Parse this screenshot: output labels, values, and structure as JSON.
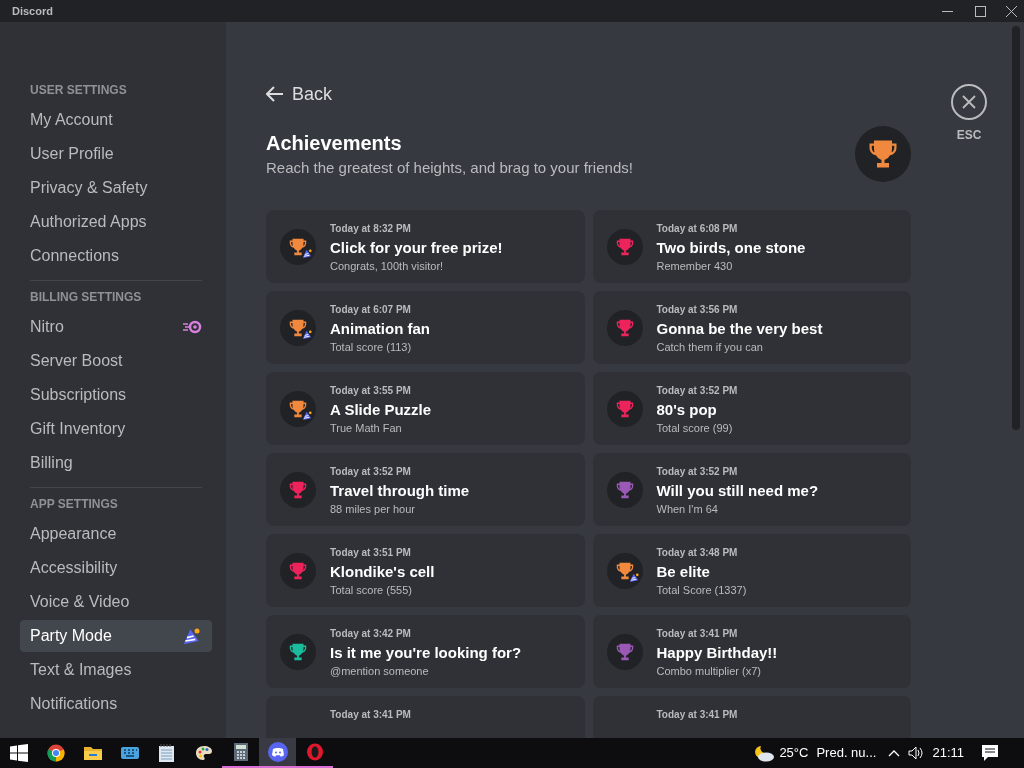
{
  "window": {
    "title": "Discord"
  },
  "sidebar": {
    "sections": [
      {
        "header": "USER SETTINGS",
        "items": [
          {
            "label": "My Account",
            "selected": false,
            "kind": "plain"
          },
          {
            "label": "User Profile",
            "selected": false,
            "kind": "plain"
          },
          {
            "label": "Privacy & Safety",
            "selected": false,
            "kind": "plain"
          },
          {
            "label": "Authorized Apps",
            "selected": false,
            "kind": "plain"
          },
          {
            "label": "Connections",
            "selected": false,
            "kind": "plain"
          }
        ]
      },
      {
        "header": "BILLING SETTINGS",
        "items": [
          {
            "label": "Nitro",
            "selected": false,
            "kind": "nitro"
          },
          {
            "label": "Server Boost",
            "selected": false,
            "kind": "plain"
          },
          {
            "label": "Subscriptions",
            "selected": false,
            "kind": "plain"
          },
          {
            "label": "Gift Inventory",
            "selected": false,
            "kind": "plain"
          },
          {
            "label": "Billing",
            "selected": false,
            "kind": "plain"
          }
        ]
      },
      {
        "header": "APP SETTINGS",
        "items": [
          {
            "label": "Appearance",
            "selected": false,
            "kind": "plain"
          },
          {
            "label": "Accessibility",
            "selected": false,
            "kind": "plain"
          },
          {
            "label": "Voice & Video",
            "selected": false,
            "kind": "plain"
          },
          {
            "label": "Party Mode",
            "selected": true,
            "kind": "party"
          },
          {
            "label": "Text & Images",
            "selected": false,
            "kind": "plain"
          },
          {
            "label": "Notifications",
            "selected": false,
            "kind": "plain"
          }
        ]
      }
    ]
  },
  "page": {
    "back": "Back",
    "title": "Achievements",
    "subtitle": "Reach the greatest of heights, and brag to your friends!",
    "close_label": "ESC"
  },
  "achievements": [
    {
      "time": "Today at 8:32 PM",
      "title": "Click for your free prize!",
      "description": "Congrats, 100th visitor!",
      "color": "#f0883e",
      "party": true
    },
    {
      "time": "Today at 6:08 PM",
      "title": "Two birds, one stone",
      "description": "Remember 430",
      "color": "#ed245c",
      "party": false
    },
    {
      "time": "Today at 6:07 PM",
      "title": "Animation fan",
      "description": "Total score (113)",
      "color": "#f0883e",
      "party": true
    },
    {
      "time": "Today at 3:56 PM",
      "title": "Gonna be the very best",
      "description": "Catch them if you can",
      "color": "#ed245c",
      "party": false
    },
    {
      "time": "Today at 3:55 PM",
      "title": "A Slide Puzzle",
      "description": "True Math Fan",
      "color": "#f0883e",
      "party": true
    },
    {
      "time": "Today at 3:52 PM",
      "title": "80's pop",
      "description": "Total score (99)",
      "color": "#ed245c",
      "party": false
    },
    {
      "time": "Today at 3:52 PM",
      "title": "Travel through time",
      "description": "88 miles per hour",
      "color": "#ed245c",
      "party": false
    },
    {
      "time": "Today at 3:52 PM",
      "title": "Will you still need me?",
      "description": "When I'm 64",
      "color": "#9b59b6",
      "party": false
    },
    {
      "time": "Today at 3:51 PM",
      "title": "Klondike's cell",
      "description": "Total score (555)",
      "color": "#ed245c",
      "party": false
    },
    {
      "time": "Today at 3:48 PM",
      "title": "Be elite",
      "description": "Total Score (1337)",
      "color": "#f0883e",
      "party": true
    },
    {
      "time": "Today at 3:42 PM",
      "title": "Is it me you're looking for?",
      "description": "@mention someone",
      "color": "#1abc9c",
      "party": false
    },
    {
      "time": "Today at 3:41 PM",
      "title": "Happy Birthday!!",
      "description": "Combo multiplier (x7)",
      "color": "#9b59b6",
      "party": false
    },
    {
      "time": "Today at 3:41 PM"
    },
    {
      "time": "Today at 3:41 PM"
    }
  ],
  "taskbar": {
    "apps": [
      {
        "kind": "start",
        "running": false,
        "selected": false
      },
      {
        "kind": "chrome",
        "running": false,
        "selected": false
      },
      {
        "kind": "folder",
        "running": false,
        "selected": false
      },
      {
        "kind": "keyboard",
        "running": false,
        "selected": false
      },
      {
        "kind": "notepad",
        "running": false,
        "selected": false
      },
      {
        "kind": "paint",
        "running": false,
        "selected": false
      },
      {
        "kind": "calculator",
        "running": true,
        "selected": false
      },
      {
        "kind": "discord",
        "running": true,
        "selected": true
      },
      {
        "kind": "opera",
        "running": true,
        "selected": false
      }
    ],
    "temperature": "25°C",
    "weather": "Pred. nu...",
    "time": "21:11"
  }
}
